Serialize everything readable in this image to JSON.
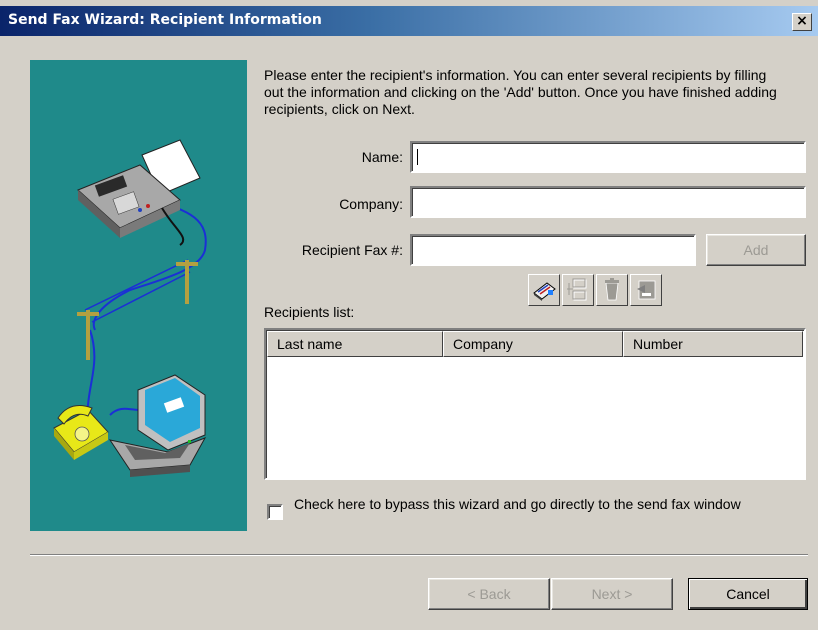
{
  "window": {
    "title": "Send Fax Wizard: Recipient Information",
    "close_glyph": "×"
  },
  "instructions": "Please enter the recipient's information. You can enter several recipients by filling out the information and clicking  on the 'Add' button. Once you have finished adding recipients, click on Next.",
  "form": {
    "name_label": "Name:",
    "name_value": "",
    "company_label": "Company:",
    "company_value": "",
    "fax_label": "Recipient Fax #:",
    "fax_value": "",
    "add_button": "Add"
  },
  "toolbar": {
    "icons": [
      "address-book-icon",
      "properties-icon",
      "delete-icon",
      "import-icon"
    ]
  },
  "recipients": {
    "label": "Recipients list:",
    "columns": [
      "Last name",
      "Company",
      "Number"
    ],
    "rows": []
  },
  "bypass": {
    "label": "Check here to bypass this wizard and go directly to the send fax window",
    "checked": false
  },
  "buttons": {
    "back": "< Back",
    "next": "Next >",
    "cancel": "Cancel"
  },
  "colors": {
    "illustration_bg": "#1f8a8a",
    "title_bar": "#0a246a"
  }
}
